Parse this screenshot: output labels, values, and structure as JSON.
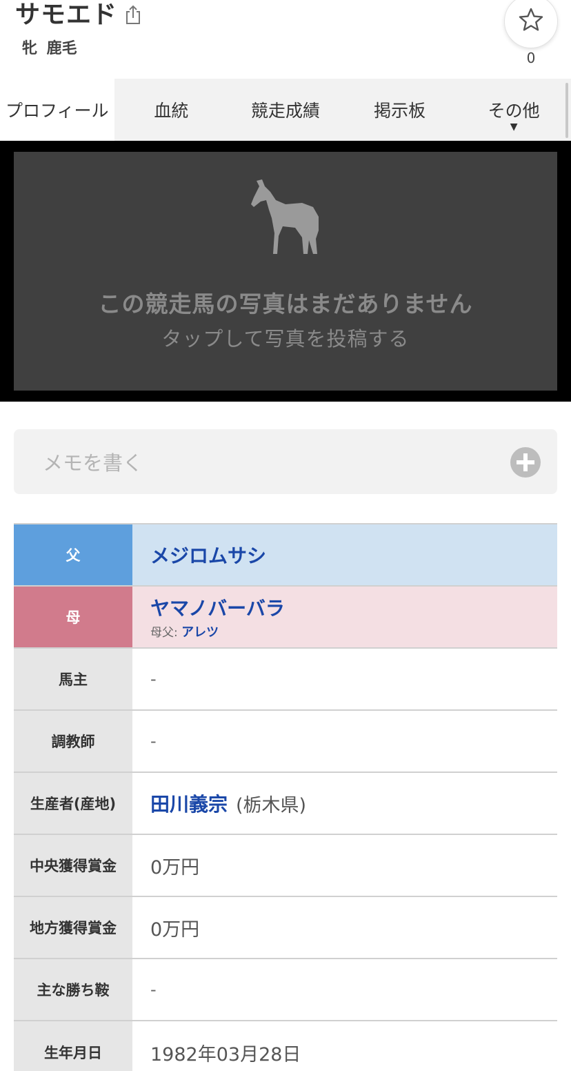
{
  "header": {
    "horse_name": "サモエド",
    "sex_coat": "牝 鹿毛",
    "favorite_count": "0"
  },
  "tabs": [
    {
      "label": "プロフィール",
      "active": true
    },
    {
      "label": "血統"
    },
    {
      "label": "競走成績"
    },
    {
      "label": "掲示板"
    },
    {
      "label": "その他",
      "dropdown": true
    }
  ],
  "photo": {
    "message": "この競走馬の写真はまだありません",
    "tap_text": "タップして写真を投稿する"
  },
  "memo": {
    "placeholder": "メモを書く"
  },
  "info": {
    "sire_label": "父",
    "sire_name": "メジロムサシ",
    "dam_label": "母",
    "dam_name": "ヤマノバーバラ",
    "dam_sire_label": "母父:",
    "dam_sire_name": "アレツ",
    "owner_label": "馬主",
    "owner_value": "-",
    "trainer_label": "調教師",
    "trainer_value": "-",
    "breeder_label": "生産者(産地)",
    "breeder_name": "田川義宗",
    "breeder_region": "(栃木県)",
    "central_prize_label": "中央獲得賞金",
    "central_prize_value": "0万円",
    "local_prize_label": "地方獲得賞金",
    "local_prize_value": "0万円",
    "main_wins_label": "主な勝ち鞍",
    "main_wins_value": "-",
    "birthdate_label": "生年月日",
    "birthdate_value": "1982年03月28日"
  },
  "colors": {
    "sire_header": "#5e9fdd",
    "sire_bg": "#d0e2f2",
    "dam_header": "#d17b8c",
    "dam_bg": "#f4dfe3",
    "link": "#1a47a8"
  }
}
